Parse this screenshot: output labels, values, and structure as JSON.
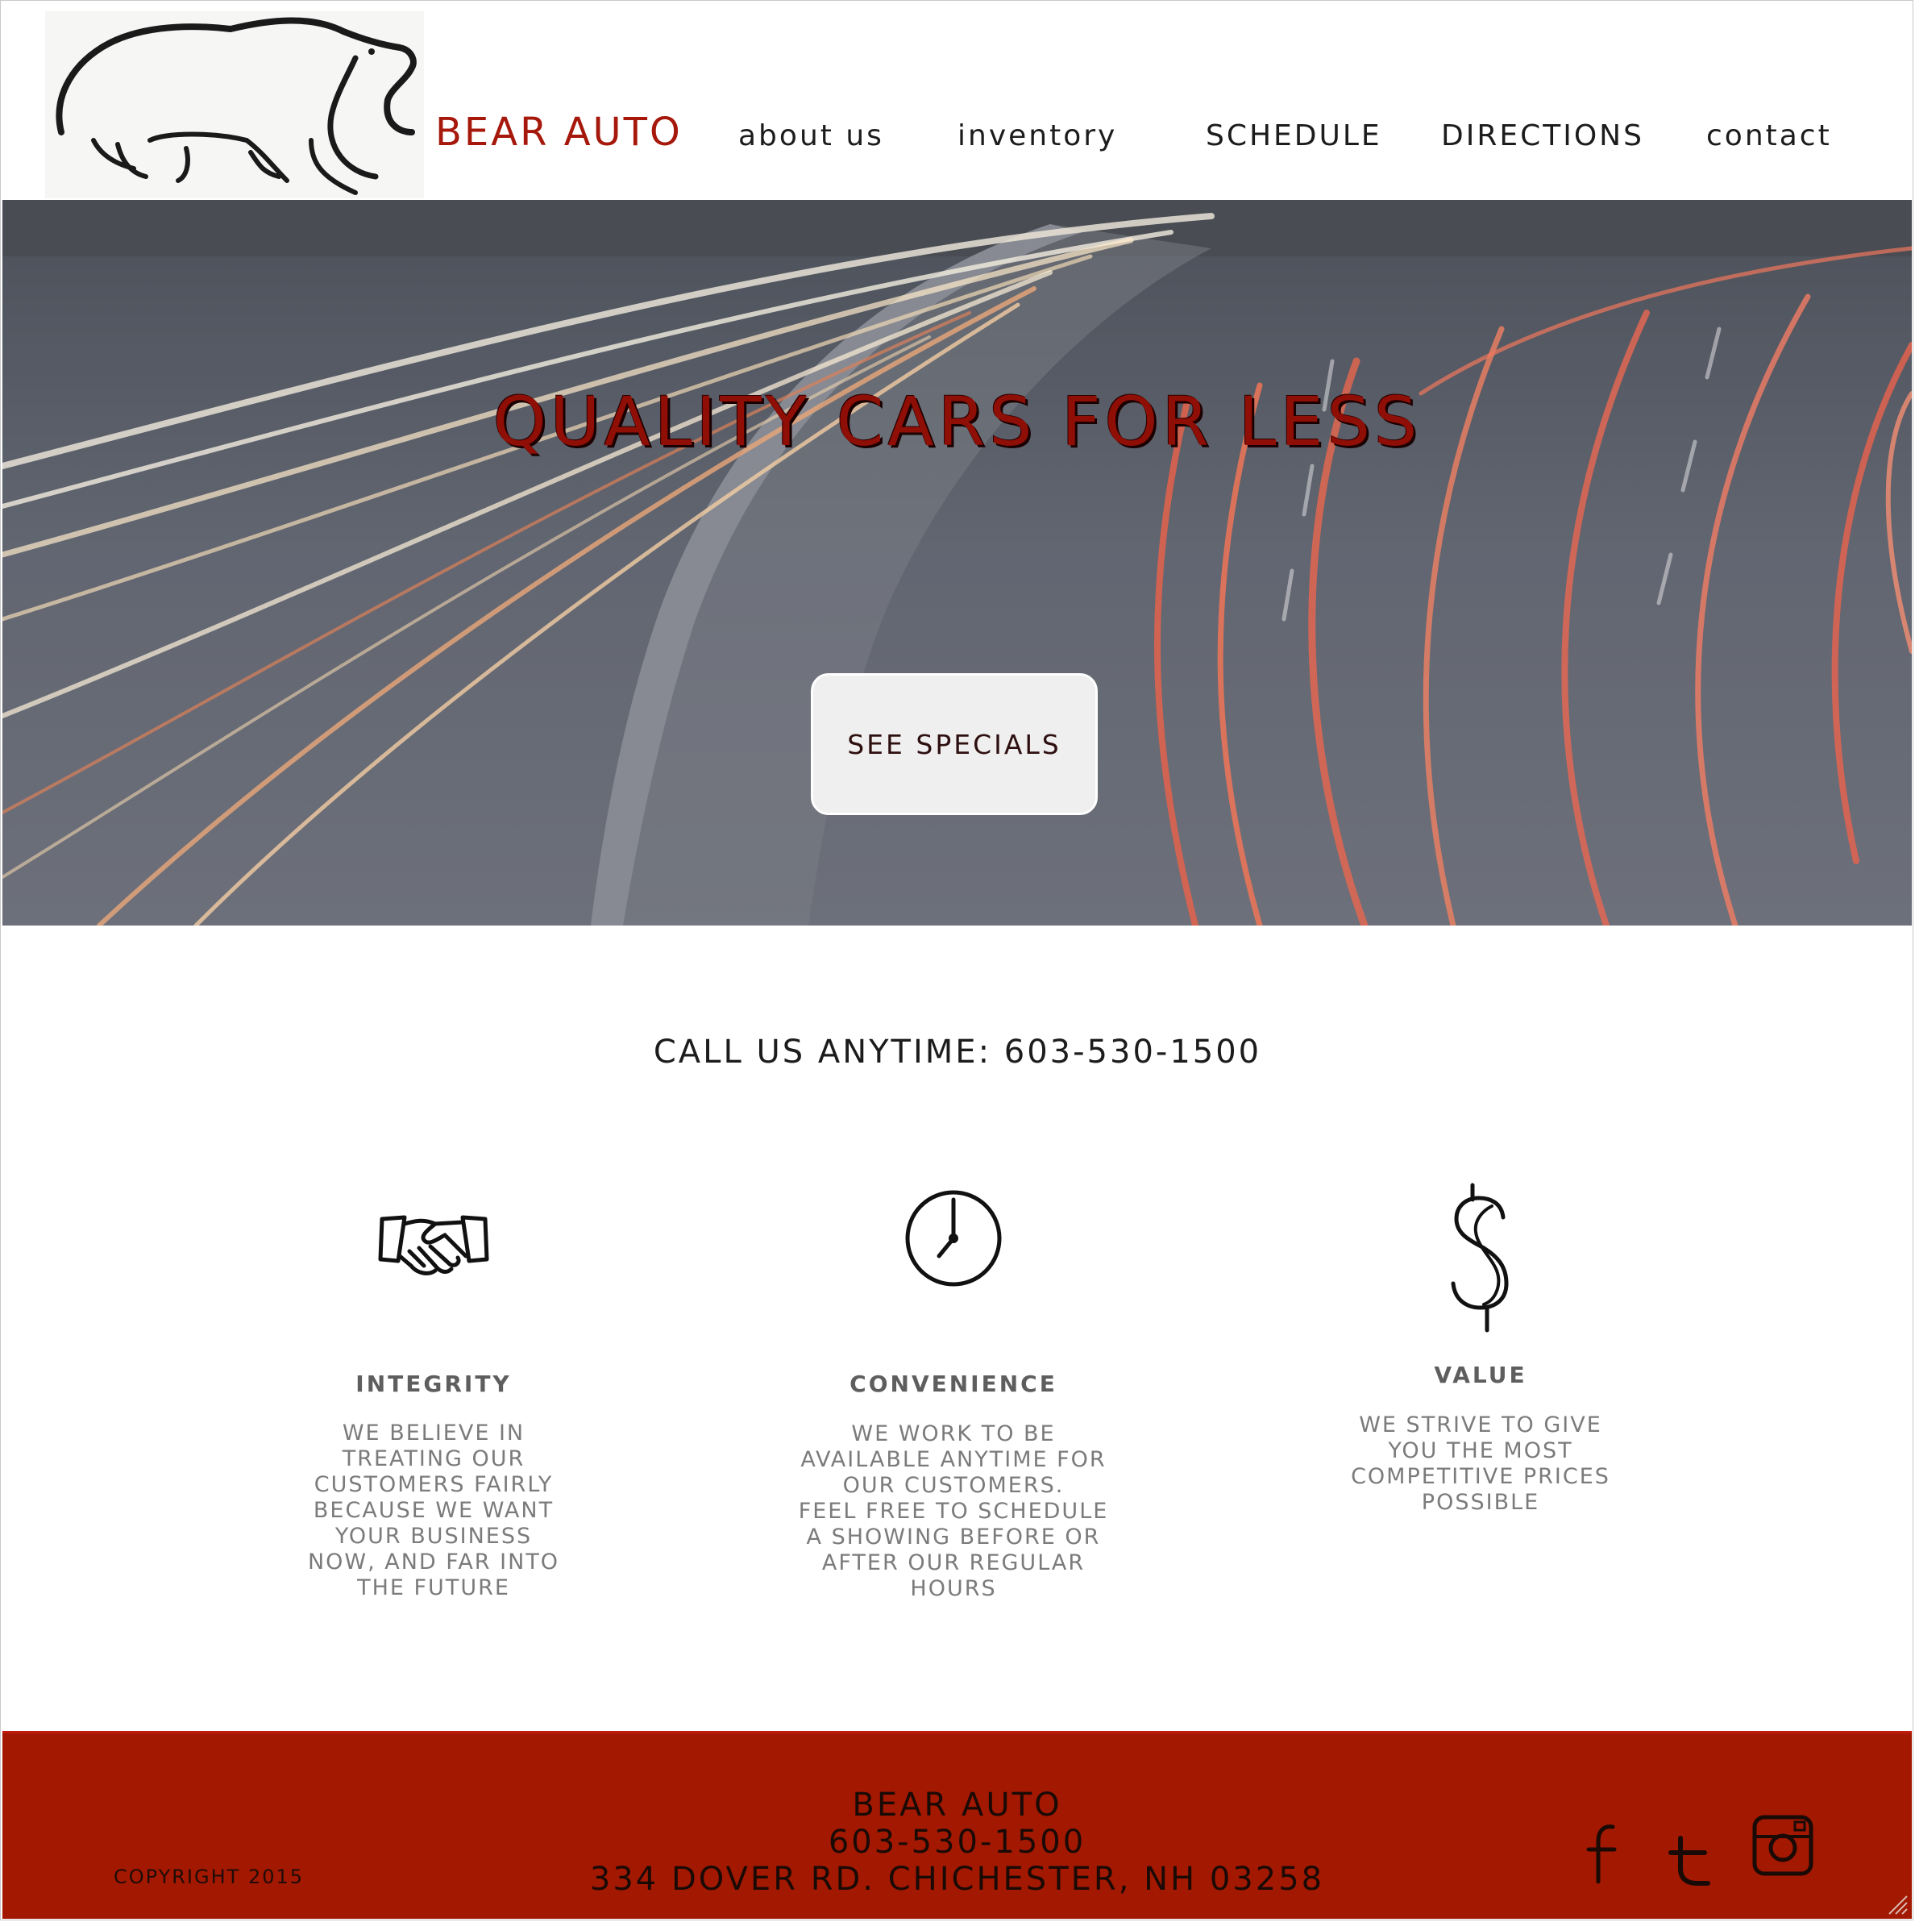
{
  "brand": {
    "name": "BEAR AUTO",
    "color": "#a5180b",
    "logo_icon": "bear-icon"
  },
  "nav": {
    "items": [
      {
        "label": "about us"
      },
      {
        "label": "inventory"
      },
      {
        "label": "SCHEDULE"
      },
      {
        "label": "DIRECTIONS"
      },
      {
        "label": "contact"
      }
    ]
  },
  "hero": {
    "title": "QUALITY CARS FOR LESS",
    "button_label": "SEE SPECIALS",
    "title_color": "#8f0e06"
  },
  "call_line": "CALL US ANYTIME: 603-530-1500",
  "features": [
    {
      "icon": "handshake-icon",
      "title": "INTEGRITY",
      "lines": [
        "WE BELIEVE IN",
        "TREATING OUR",
        "CUSTOMERS FAIRLY",
        "BECAUSE WE WANT",
        "YOUR BUSINESS",
        "NOW, AND FAR INTO",
        "THE FUTURE"
      ]
    },
    {
      "icon": "clock-icon",
      "title": "CONVENIENCE",
      "lines": [
        "WE WORK TO BE",
        "AVAILABLE ANYTIME FOR",
        "OUR CUSTOMERS.",
        "FEEL FREE TO SCHEDULE",
        "A SHOWING BEFORE OR",
        "AFTER OUR REGULAR",
        "HOURS"
      ]
    },
    {
      "icon": "dollar-icon",
      "title": "VALUE",
      "lines": [
        "WE STRIVE TO GIVE",
        "YOU THE MOST",
        "COMPETITIVE PRICES",
        "POSSIBLE"
      ]
    }
  ],
  "footer": {
    "copyright": "COPYRIGHT 2015",
    "name": "BEAR AUTO",
    "phone": "603-530-1500",
    "address": "334 DOVER RD. CHICHESTER, NH 03258",
    "background": "#a31800",
    "social": [
      "facebook-icon",
      "twitter-icon",
      "instagram-icon"
    ]
  }
}
